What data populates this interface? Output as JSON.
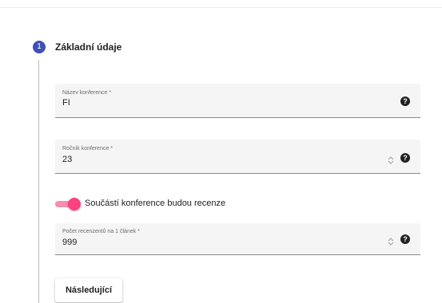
{
  "stepper": {
    "step_number": "1",
    "step_title": "Základní údaje"
  },
  "fields": {
    "name": {
      "label": "Název konference *",
      "value": "FI",
      "icon": "help-icon"
    },
    "year": {
      "label": "Ročník konference *",
      "value": "23",
      "icon": "help-icon"
    },
    "reviewers": {
      "label": "Počet recenzentů na 1 článek *",
      "value": "999",
      "icon": "help-icon"
    }
  },
  "toggle": {
    "label": "Součástí konference budou recenze",
    "checked": true,
    "accent_color": "#ff4081"
  },
  "actions": {
    "next_label": "Následující"
  },
  "colors": {
    "step_circle": "#3f51b5",
    "field_background": "#f5f5f5"
  }
}
